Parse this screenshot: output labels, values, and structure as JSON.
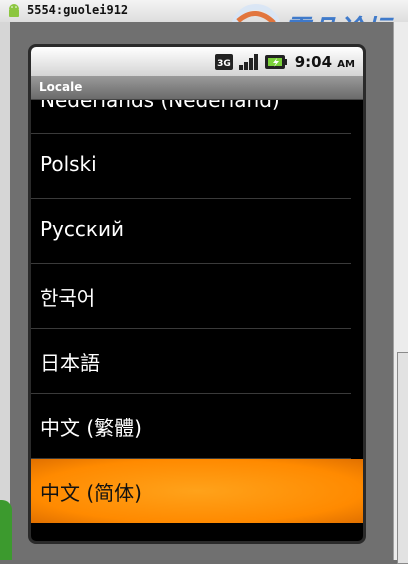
{
  "window": {
    "title": "5554:guolei912"
  },
  "status": {
    "network": "3G",
    "time": "9:04",
    "ampm": "AM"
  },
  "screen": {
    "title": "Locale"
  },
  "locales": [
    {
      "label": "Nederlands (Nederland)"
    },
    {
      "label": "Polski"
    },
    {
      "label": "Русский"
    },
    {
      "label": "한국어"
    },
    {
      "label": "日本語"
    },
    {
      "label": "中文 (繁體)"
    },
    {
      "label": "中文 (简体)",
      "selected": true
    }
  ],
  "colors": {
    "selection": "#ff9000",
    "list_background": "#000000",
    "title_bar": "#7d7d7d"
  }
}
